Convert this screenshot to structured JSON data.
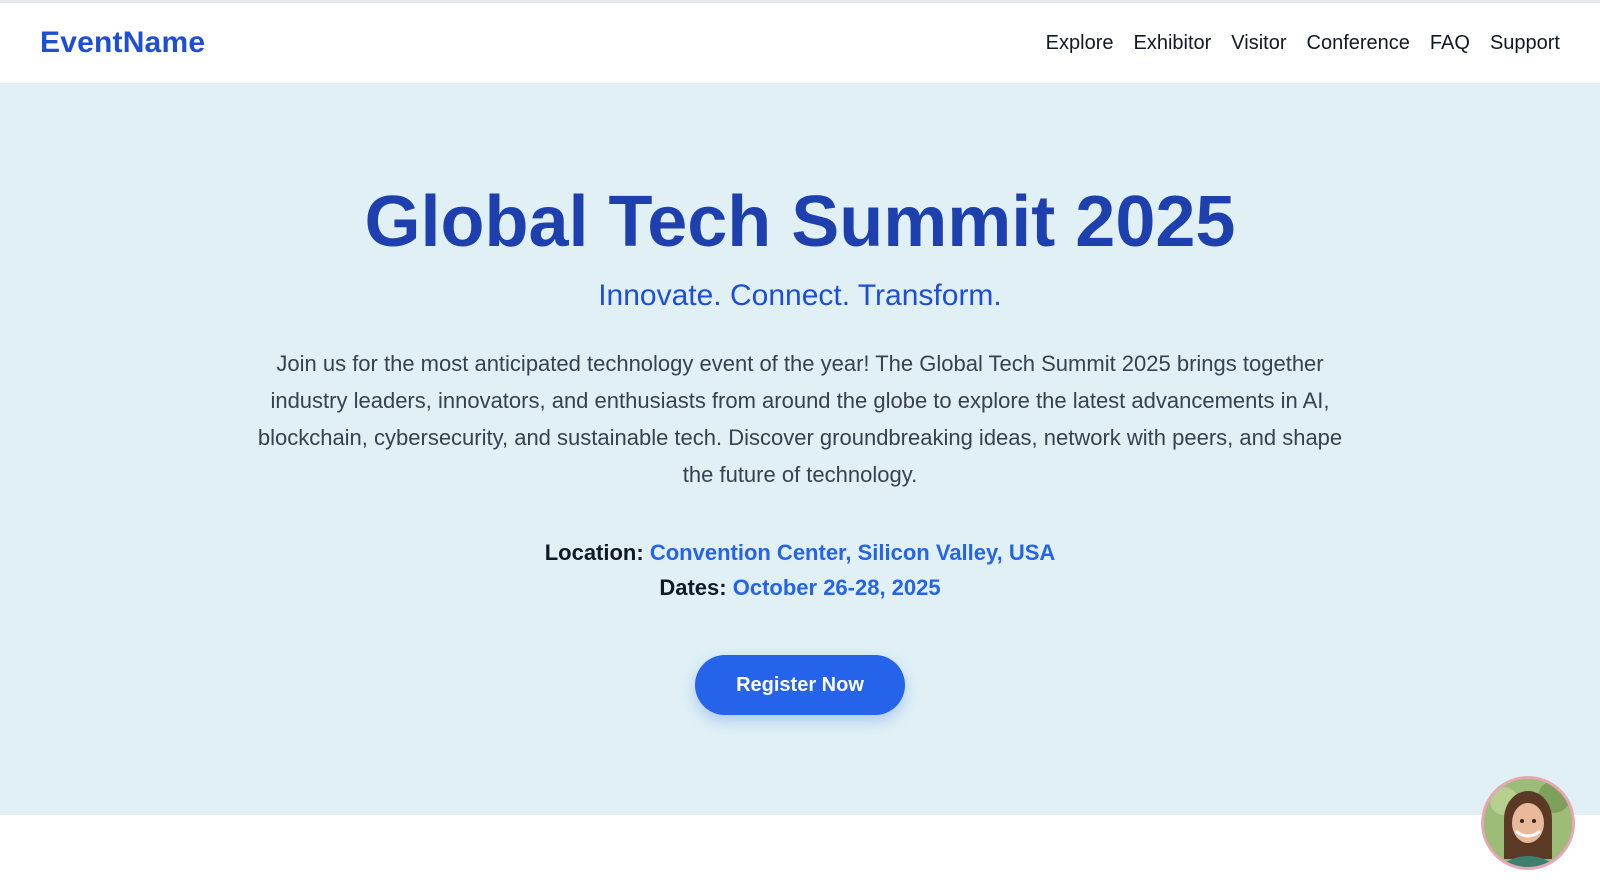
{
  "brand": "EventName",
  "nav": {
    "items": [
      "Explore",
      "Exhibitor",
      "Visitor",
      "Conference",
      "FAQ",
      "Support"
    ]
  },
  "hero": {
    "title": "Global Tech Summit 2025",
    "tagline": "Innovate. Connect. Transform.",
    "description": "Join us for the most anticipated technology event of the year! The Global Tech Summit 2025 brings together industry leaders, innovators, and enthusiasts from around the globe to explore the latest advancements in AI, blockchain, cybersecurity, and sustainable tech. Discover groundbreaking ideas, network with peers, and shape the future of technology.",
    "location_label": "Location:",
    "location_value": "Convention Center, Silicon Valley, USA",
    "dates_label": "Dates:",
    "dates_value": "October 26-28, 2025",
    "cta_label": "Register Now"
  },
  "colors": {
    "brand": "#1d4ed8",
    "title": "#1e40af",
    "accent": "#2563eb",
    "hero_bg": "#e0f0f5"
  }
}
